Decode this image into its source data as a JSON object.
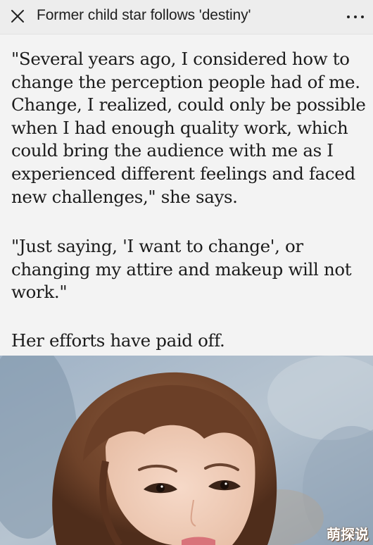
{
  "header": {
    "title": "Former child star follows 'destiny'",
    "close_icon": "close-icon",
    "more_icon": "more-options-icon"
  },
  "article": {
    "paragraphs": [
      "\"Several years ago, I considered how to change the perception people had of me. Change, I realized, could only be possible when I had enough quality work, which could bring the audience with me as I experienced different feelings and faced new challenges,\" she says.",
      "\"Just saying, 'I want to change', or changing my attire and makeup will not work.\"",
      "Her efforts have paid off."
    ]
  },
  "photo": {
    "watermark": "萌探说"
  },
  "colors": {
    "background": "#f3f3f3",
    "topbar": "#ededed",
    "text": "#1b1b1b"
  }
}
